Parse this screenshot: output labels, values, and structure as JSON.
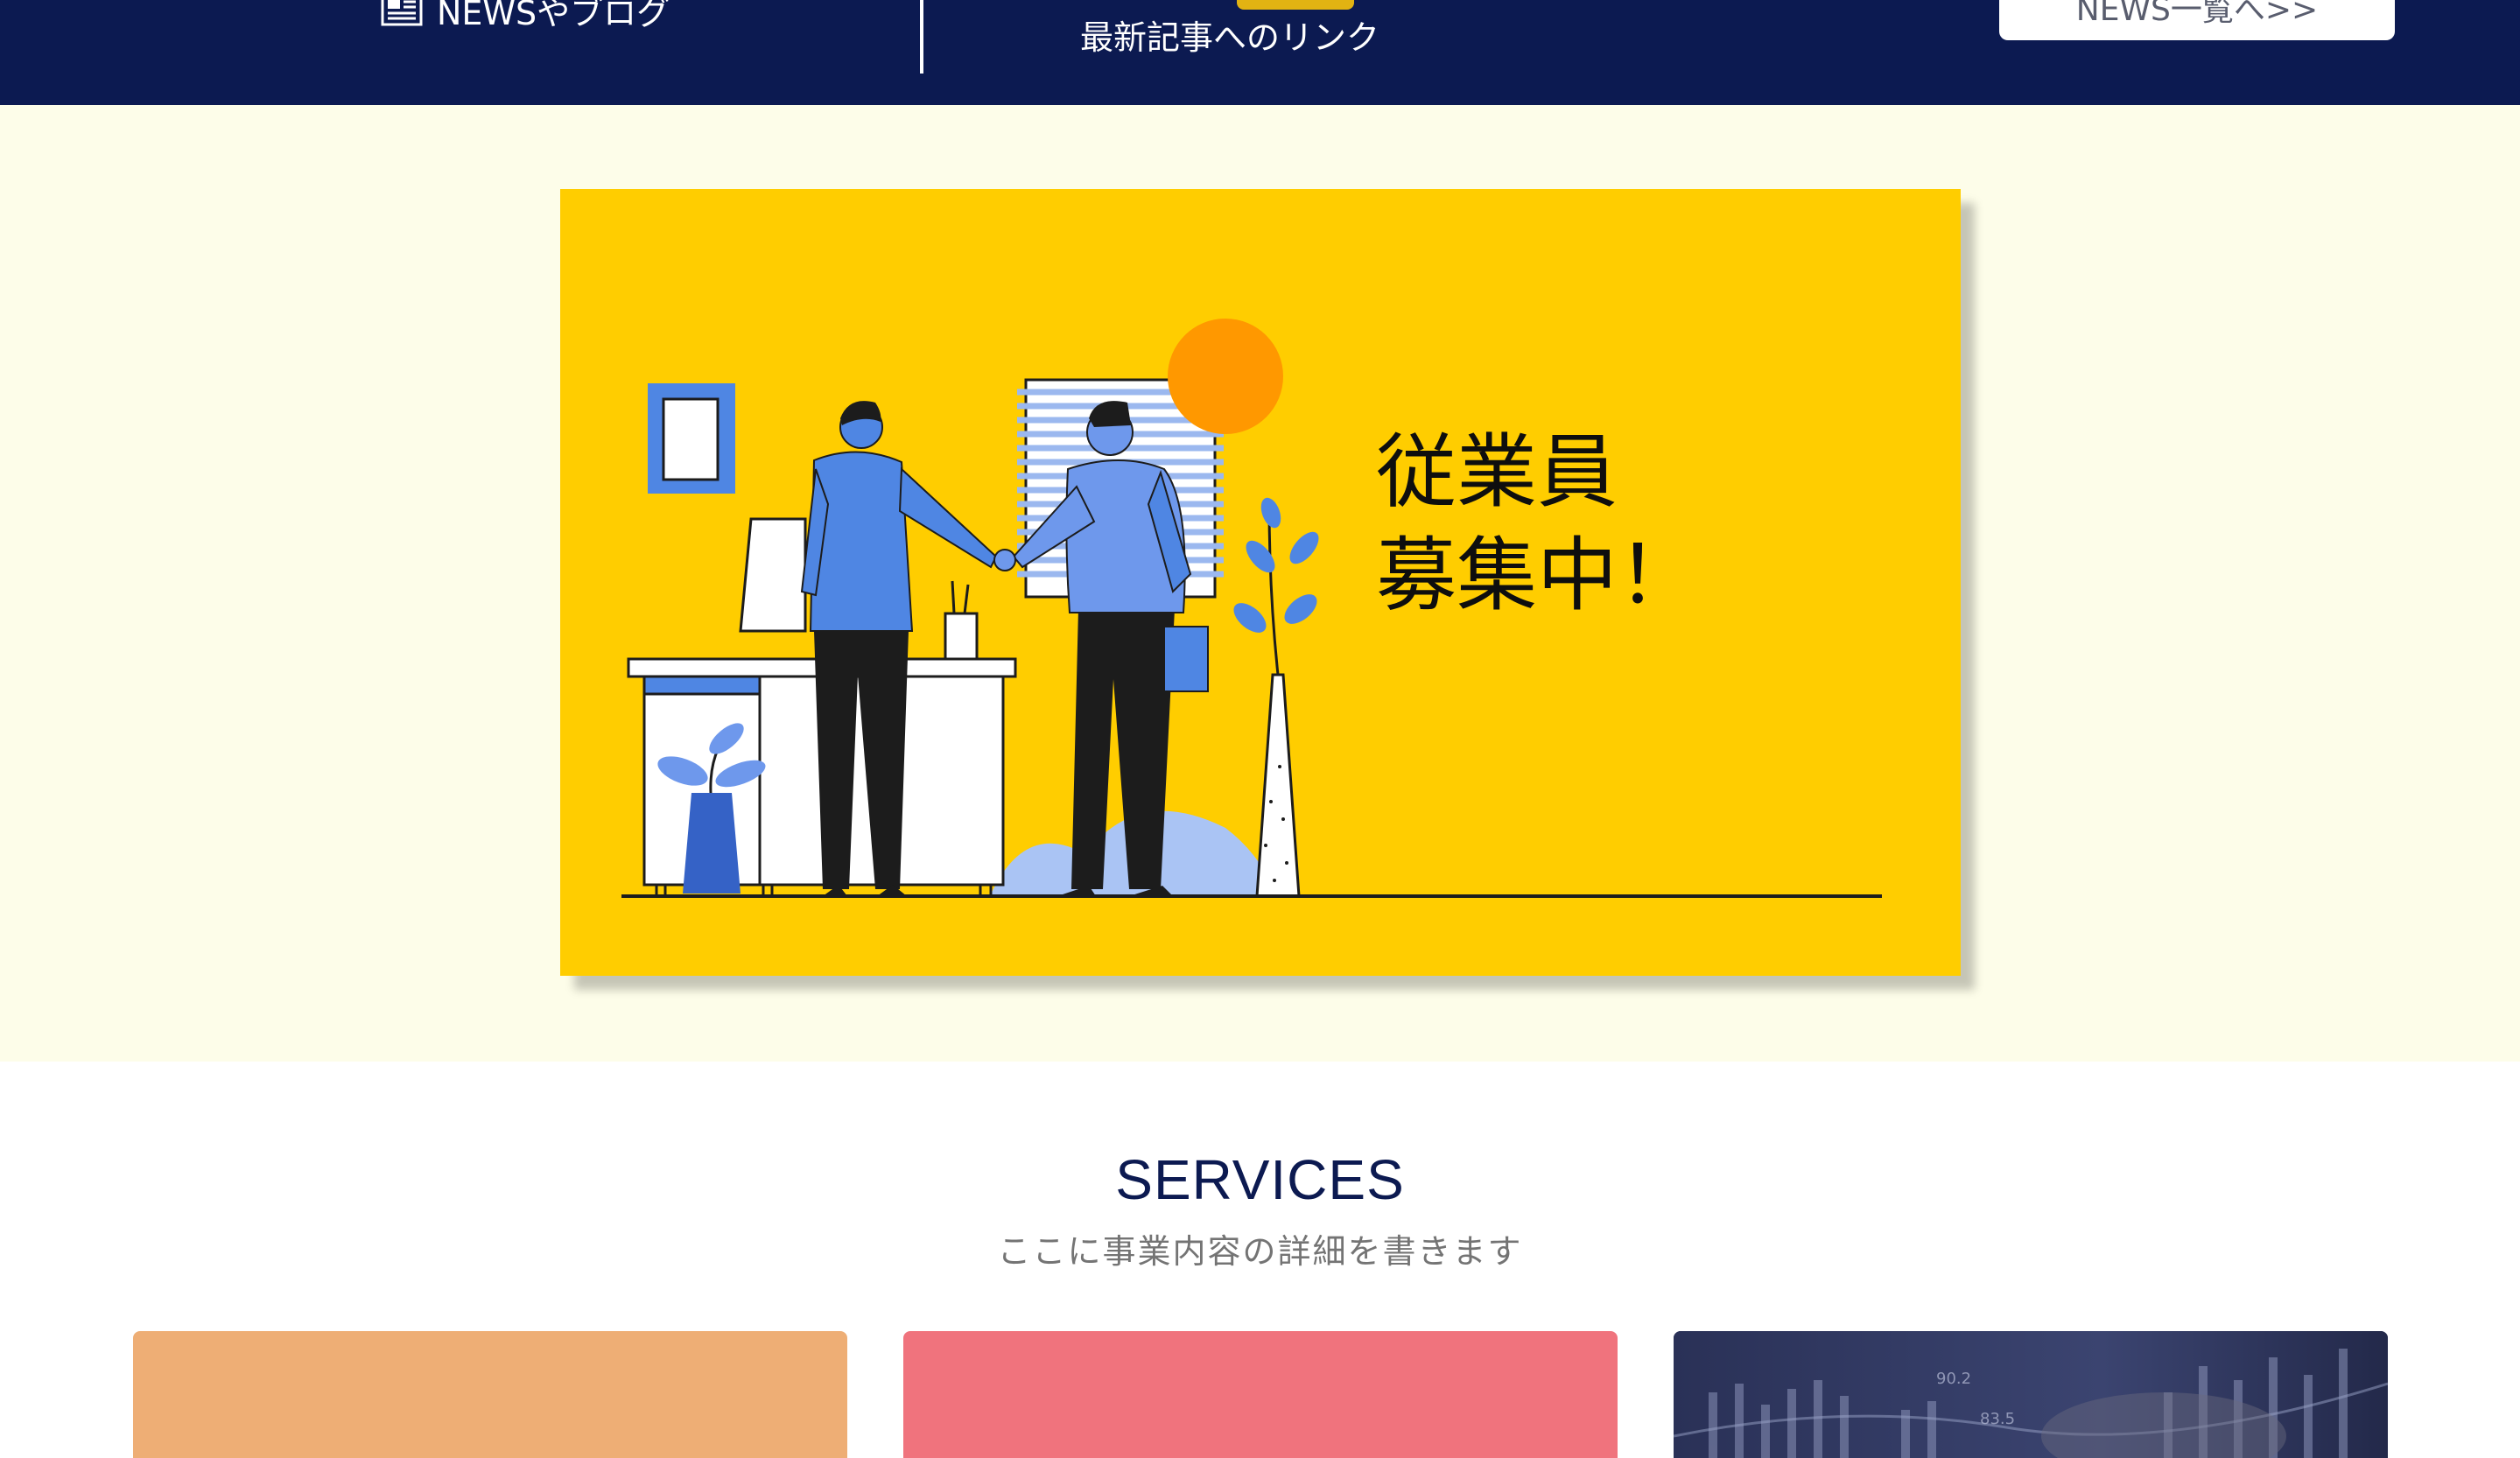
{
  "news_bar": {
    "label": "NEWSやブログ",
    "icon": "newspaper-icon",
    "latest_link": "最新記事へのリンク",
    "list_button": "NEWS一覧へ>>",
    "colors": {
      "background": "#0c1a51",
      "badge": "#e2b312"
    }
  },
  "hero": {
    "banner_lines": [
      "従業員",
      "募集中！"
    ],
    "colors": {
      "section_background": "#fdfde9",
      "banner_background": "#ffcd00"
    }
  },
  "services": {
    "title": "SERVICES",
    "subtitle": "ここに事業内容の詳細を書きます",
    "cards": [
      {
        "color": "#eeae75"
      },
      {
        "color": "#f0737d"
      },
      {
        "color": "#2c3358",
        "image": "financial-chart-photo"
      }
    ],
    "photo_labels": [
      "90.2",
      "83.5"
    ]
  }
}
